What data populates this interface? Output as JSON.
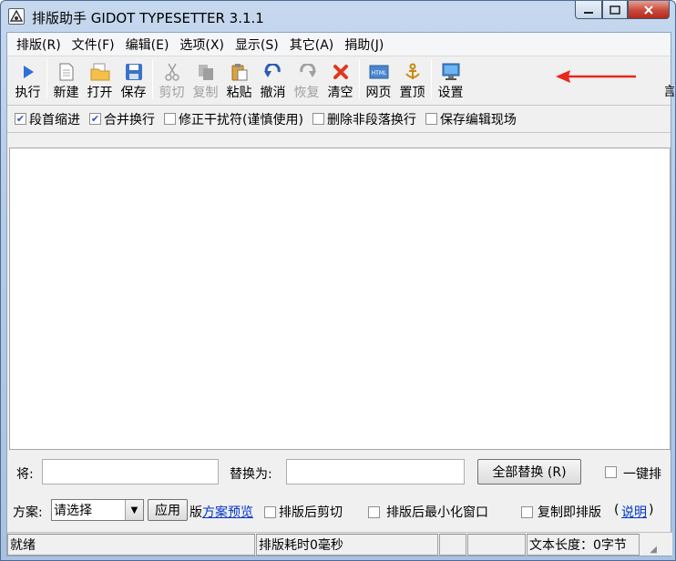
{
  "window": {
    "title": "排版助手 GIDOT TYPESETTER 3.1.1"
  },
  "menu": [
    "排版(R)",
    "文件(F)",
    "编辑(E)",
    "选项(X)",
    "显示(S)",
    "其它(A)",
    "捐助(J)"
  ],
  "toolbar": {
    "execute": "执行",
    "new": "新建",
    "open": "打开",
    "save": "保存",
    "cut": "剪切",
    "copy": "复制",
    "paste": "粘贴",
    "undo": "撤消",
    "redo": "恢复",
    "clear": "清空",
    "webpage": "网页",
    "top": "置顶",
    "settings": "设置",
    "overflow": "言"
  },
  "options": {
    "indent": {
      "label": "段首缩进",
      "checked": true
    },
    "merge": {
      "label": "合并换行",
      "checked": true
    },
    "fix_noise": {
      "label": "修正干扰符(谨慎使用)",
      "checked": false
    },
    "remove_non_para": {
      "label": "删除非段落换行",
      "checked": false
    },
    "save_scene": {
      "label": "保存编辑现场",
      "checked": false
    }
  },
  "replace": {
    "find_label": "将:",
    "find_value": "",
    "replace_label": "替换为:",
    "replace_value": "",
    "replace_all_button": "全部替换 (R)",
    "one_click_label": "一键排"
  },
  "scheme": {
    "label": "方案:",
    "selected": "请选择",
    "apply_button": "应用",
    "preview_prefix": "版",
    "preview_link": "方案预览",
    "cut_after": "排版后剪切",
    "minimize_after": "排版后最小化窗口",
    "copy_typeset": "复制即排版",
    "help_link": "说明",
    "help_open": "(",
    "help_close": ")"
  },
  "status": {
    "state": "就绪",
    "elapsed": "排版耗时0毫秒",
    "length": "文本长度：0字节"
  },
  "colors": {
    "annotation_arrow": "#e8261a",
    "link": "#0033cc"
  }
}
